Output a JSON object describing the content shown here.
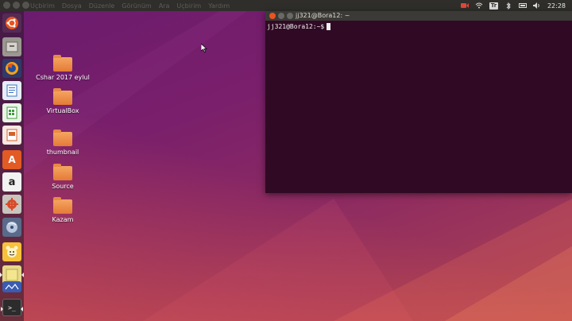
{
  "topbar": {
    "menu": [
      "Uçbirim",
      "Dosya",
      "Düzenle",
      "Görünüm",
      "Ara",
      "Uçbirim",
      "Yardım"
    ],
    "tray": {
      "icons": [
        "camera-record-icon",
        "wifi-icon",
        "keyboard-layout-icon",
        "bluetooth-icon",
        "battery-icon",
        "volume-icon"
      ],
      "keyboard_label": "Tr",
      "clock": "22:28"
    }
  },
  "launcher": {
    "items": [
      "ubuntu-dash",
      "files",
      "firefox",
      "libreoffice-writer",
      "libreoffice-calc",
      "libreoffice-impress",
      "ubuntu-software",
      "amazon",
      "system-settings",
      "disk-utility",
      "unknown-app",
      "notes",
      "screenshot-tool",
      "terminal"
    ],
    "amazon_glyph": "a",
    "software_glyph": "A",
    "terminal_glyph": ">_"
  },
  "desktop": {
    "icons": [
      {
        "label": "Cshar 2017 eylul"
      },
      {
        "label": "VirtualBox"
      },
      {
        "label": "thumbnail"
      },
      {
        "label": "Source"
      },
      {
        "label": "Kazam"
      }
    ]
  },
  "terminal": {
    "title": "jj321@Bora12: ~",
    "prompt": "jj321@Bora12:~$"
  },
  "colors": {
    "terminal_bg": "#300a24",
    "ubuntu_orange": "#e95420",
    "topbar_bg": "#2f2e2b"
  }
}
